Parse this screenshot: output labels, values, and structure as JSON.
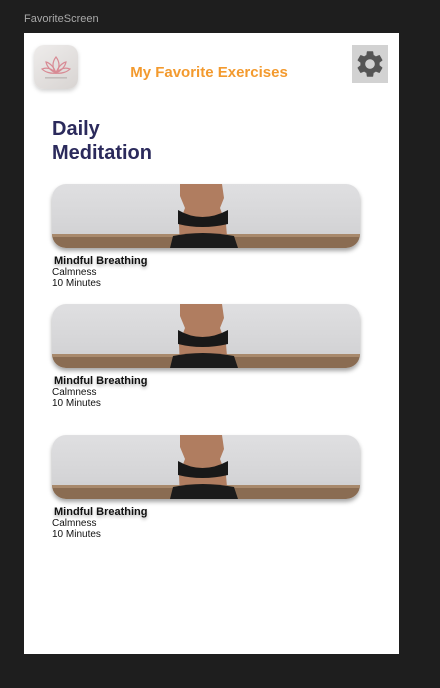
{
  "frame": {
    "label": "FavoriteScreen"
  },
  "header": {
    "title": "My Favorite Exercises",
    "logo_icon": "lotus-logo-icon",
    "settings_icon": "gear-icon"
  },
  "section": {
    "title_line1": "Daily",
    "title_line2": "Meditation"
  },
  "exercises": [
    {
      "title": "Mindful Breathing",
      "category": "Calmness",
      "duration": "10 Minutes"
    },
    {
      "title": "Mindful Breathing",
      "category": "Calmness",
      "duration": "10 Minutes"
    },
    {
      "title": "Mindful Breathing",
      "category": "Calmness",
      "duration": "10 Minutes"
    }
  ],
  "colors": {
    "accent": "#f39a2e",
    "heading": "#2b2a5c",
    "canvas": "#1e1e1e",
    "screen": "#ffffff"
  }
}
